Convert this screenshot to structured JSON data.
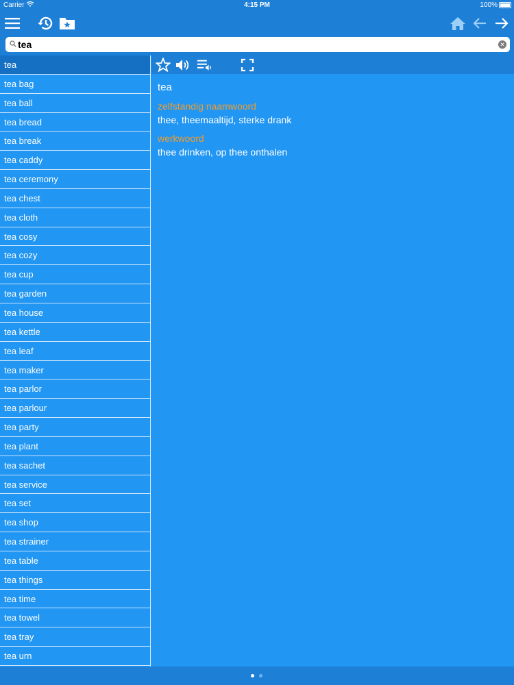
{
  "status": {
    "carrier": "Carrier",
    "time": "4:15 PM",
    "battery": "100%"
  },
  "toolbar": {
    "icons": [
      "menu-icon",
      "history-icon",
      "favorites-folder-icon",
      "home-icon",
      "back-arrow-icon",
      "forward-arrow-icon"
    ]
  },
  "search": {
    "value": "tea",
    "placeholder": ""
  },
  "list": {
    "items": [
      "tea",
      "tea bag",
      "tea ball",
      "tea bread",
      "tea break",
      "tea caddy",
      "tea ceremony",
      "tea chest",
      "tea cloth",
      "tea cosy",
      "tea cozy",
      "tea cup",
      "tea garden",
      "tea house",
      "tea kettle",
      "tea leaf",
      "tea maker",
      "tea parlor",
      "tea parlour",
      "tea party",
      "tea plant",
      "tea sachet",
      "tea service",
      "tea set",
      "tea shop",
      "tea strainer",
      "tea table",
      "tea things",
      "tea time",
      "tea towel",
      "tea tray",
      "tea urn"
    ],
    "selected_index": 0
  },
  "detail": {
    "headword": "tea",
    "entries": [
      {
        "pos": "zelfstandig naamwoord",
        "definition": "thee, theemaaltijd, sterke drank"
      },
      {
        "pos": "werkwoord",
        "definition": "thee drinken, op thee onthalen"
      }
    ]
  },
  "colors": {
    "accent_orange": "#f39c2a",
    "bar_blue": "#1e7fd6",
    "background_blue": "#2196f3",
    "selected_row": "#1570c4"
  },
  "pager": {
    "pages": 2,
    "current": 0
  }
}
